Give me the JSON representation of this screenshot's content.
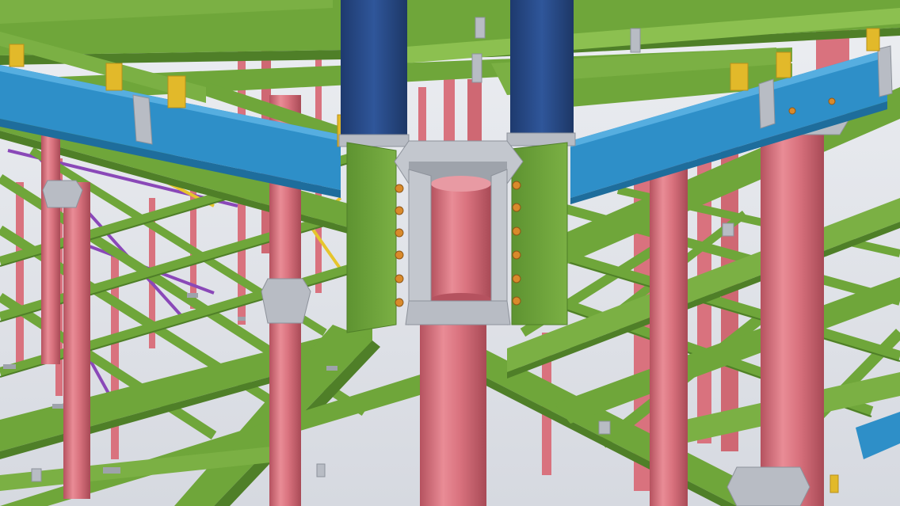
{
  "scene": {
    "subject": "",
    "colors": {
      "background": "#f2f3f6",
      "background_grad": "#d9dce3",
      "beam_green": "#6fa63a",
      "beam_green_dark": "#4f7f28",
      "beam_green_light": "#8cc050",
      "column_pink": "#d9727e",
      "column_pink_dark": "#b5525f",
      "column_pink_light": "#ef9aa3",
      "girder_blue": "#2e8fc8",
      "girder_blue_dark": "#1e6d9c",
      "column_navy": "#2c4f8f",
      "column_navy_dark": "#1e3a6e",
      "plate_grey": "#b8bcc4",
      "plate_grey_dark": "#8d929b",
      "stiffener_yellow": "#e2b92a",
      "bracing_purple": "#8a48b8",
      "bracing_yellow": "#e6c52c",
      "bolt_orange": "#d98a2b"
    }
  }
}
